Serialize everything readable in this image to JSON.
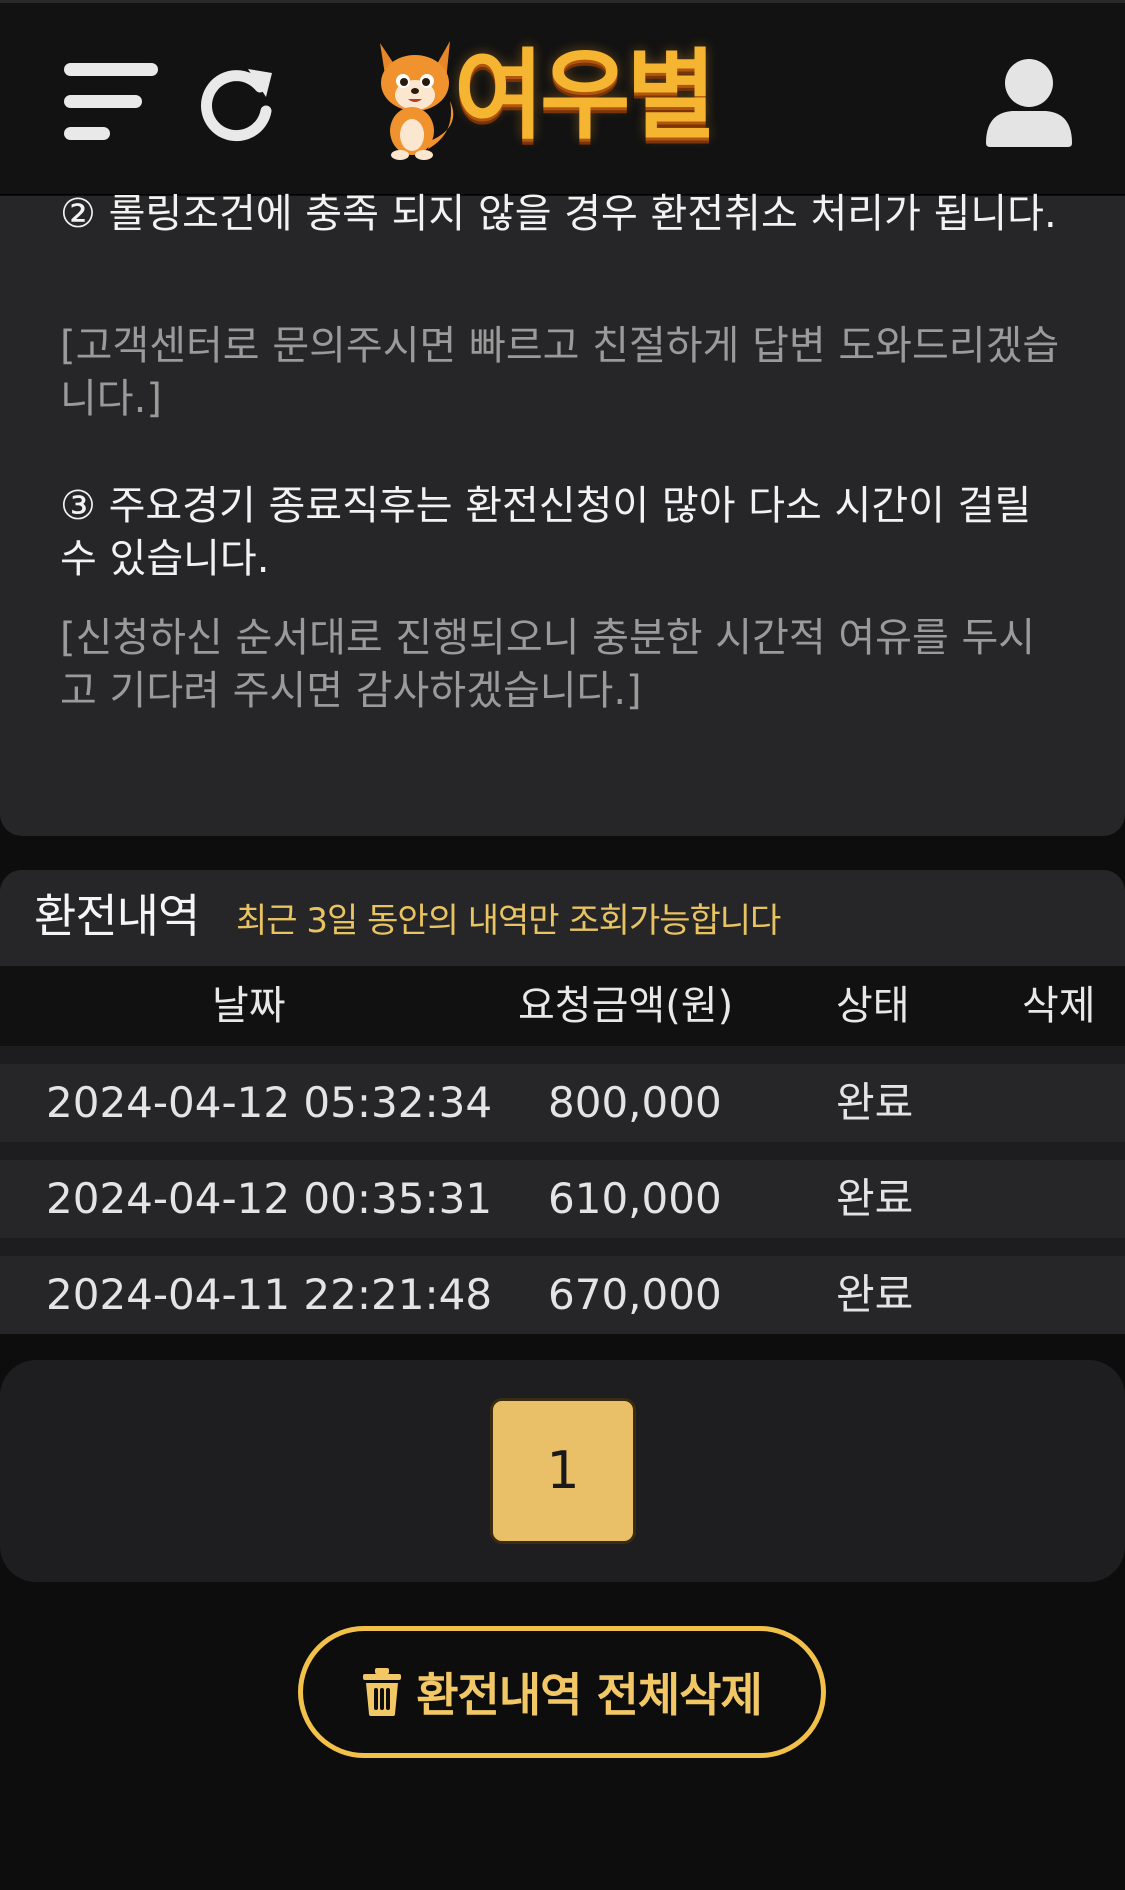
{
  "header": {
    "logo_text": "여우별",
    "menu_icon": "hamburger-icon",
    "refresh_icon": "refresh-icon",
    "user_icon": "user-icon"
  },
  "notice": {
    "item2_main": "② 롤링조건에 충족 되지 않을 경우 환전취소 처리가 됩니다.",
    "item2_sub": "[고객센터로 문의주시면 빠르고 친절하게 답변 도와드리겠습니다.]",
    "item3_main": "③ 주요경기 종료직후는 환전신청이 많아 다소 시간이 걸릴 수 있습니다.",
    "item3_sub": "[신청하신 순서대로 진행되오니 충분한 시간적 여유를 두시고 기다려 주시면 감사하겠습니다.]"
  },
  "history": {
    "title": "환전내역",
    "note": "최근 3일 동안의 내역만 조회가능합니다",
    "columns": [
      "날짜",
      "요청금액(원)",
      "상태",
      "삭제"
    ],
    "rows": [
      {
        "date": "2024-04-12 05:32:34",
        "amount": "800,000",
        "status": "완료"
      },
      {
        "date": "2024-04-12 00:35:31",
        "amount": "610,000",
        "status": "완료"
      },
      {
        "date": "2024-04-11 22:21:48",
        "amount": "670,000",
        "status": "완료"
      }
    ]
  },
  "pagination": {
    "current_page": "1"
  },
  "delete_all": {
    "label": "환전내역 전체삭제",
    "icon": "trash-icon"
  },
  "colors": {
    "accent": "#e9c067",
    "note_text": "#e8c362",
    "background": "#0d0d0d"
  }
}
